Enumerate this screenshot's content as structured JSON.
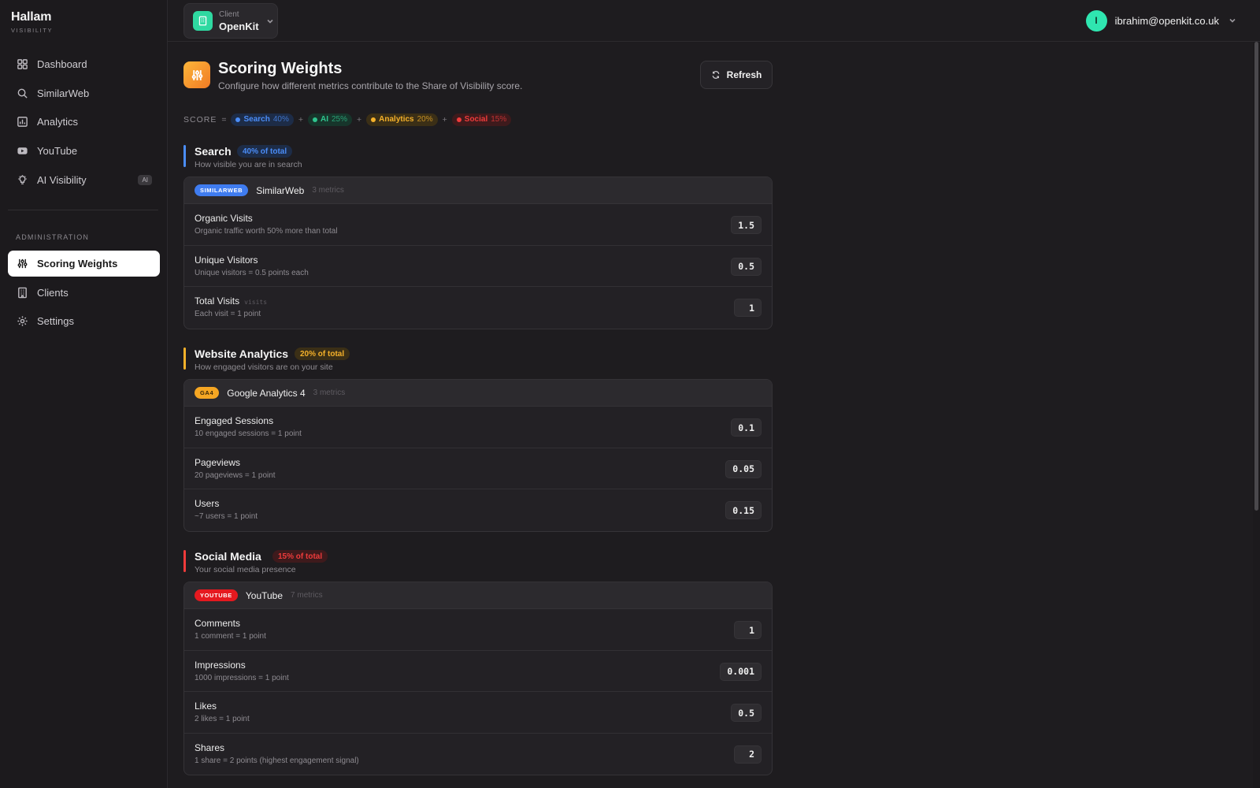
{
  "brand": {
    "name": "Hallam",
    "subtitle": "VISIBILITY"
  },
  "nav": [
    {
      "label": "Dashboard",
      "icon": "grid-icon"
    },
    {
      "label": "SimilarWeb",
      "icon": "search-icon"
    },
    {
      "label": "Analytics",
      "icon": "bar-chart-icon"
    },
    {
      "label": "YouTube",
      "icon": "youtube-icon"
    },
    {
      "label": "AI Visibility",
      "icon": "lightbulb-icon",
      "badge": "AI"
    }
  ],
  "admin": {
    "section_label": "ADMINISTRATION",
    "items": [
      {
        "label": "Scoring Weights",
        "icon": "sliders-icon",
        "active": true
      },
      {
        "label": "Clients",
        "icon": "building-icon"
      },
      {
        "label": "Settings",
        "icon": "gear-icon"
      }
    ]
  },
  "topbar": {
    "client_label": "Client",
    "client_name": "OpenKit",
    "user_initial": "I",
    "user_email": "ibrahim@openkit.co.uk"
  },
  "page": {
    "title": "Scoring Weights",
    "subtitle": "Configure how different metrics contribute to the Share of Visibility score.",
    "refresh_label": "Refresh"
  },
  "formula": {
    "label": "SCORE",
    "equals": "=",
    "plus": "+",
    "parts": [
      {
        "name": "Search",
        "pct": "40%",
        "color": "#4b8df8",
        "bg": "#1d2c47"
      },
      {
        "name": "AI",
        "pct": "25%",
        "color": "#2fc48e",
        "bg": "#17352b"
      },
      {
        "name": "Analytics",
        "pct": "20%",
        "color": "#f5b12a",
        "bg": "#3b2f16"
      },
      {
        "name": "Social",
        "pct": "15%",
        "color": "#ef3b3b",
        "bg": "#3e1a1c"
      }
    ]
  },
  "sections": [
    {
      "title": "Search",
      "badge": "40% of total",
      "color": "#4b8df8",
      "badge_bg": "#1d2c47",
      "description": "How visible you are in search",
      "source_tag": "SIMILARWEB",
      "tag_bg": "#3f7cf0",
      "tag_fg": "#ffffff",
      "source_name": "SimilarWeb",
      "metrics_count": "3 metrics",
      "rows": [
        {
          "name": "Organic Visits",
          "desc": "Organic traffic worth 50% more than total",
          "value": "1.5"
        },
        {
          "name": "Unique Visitors",
          "desc": "Unique visitors = 0.5 points each",
          "value": "0.5"
        },
        {
          "name": "Total Visits",
          "tech": "visits",
          "desc": "Each visit = 1 point",
          "value": "1"
        }
      ]
    },
    {
      "title": "Website Analytics",
      "badge": "20% of total",
      "color": "#f5b12a",
      "badge_bg": "#3b2f16",
      "description": "How engaged visitors are on your site",
      "source_tag": "GA4",
      "tag_bg": "#f5a623",
      "tag_fg": "#3a2608",
      "source_name": "Google Analytics 4",
      "metrics_count": "3 metrics",
      "rows": [
        {
          "name": "Engaged Sessions",
          "desc": "10 engaged sessions = 1 point",
          "value": "0.1"
        },
        {
          "name": "Pageviews",
          "desc": "20 pageviews = 1 point",
          "value": "0.05"
        },
        {
          "name": "Users",
          "desc": "~7 users = 1 point",
          "value": "0.15"
        }
      ]
    },
    {
      "title": "Social Media",
      "badge": "15% of total",
      "color": "#ef3b3b",
      "badge_bg": "#3e1a1c",
      "description": "Your social media presence",
      "source_tag": "YOUTUBE",
      "tag_bg": "#e5191f",
      "tag_fg": "#ffffff",
      "source_name": "YouTube",
      "metrics_count": "7 metrics",
      "rows": [
        {
          "name": "Comments",
          "desc": "1 comment = 1 point",
          "value": "1"
        },
        {
          "name": "Impressions",
          "desc": "1000 impressions = 1 point",
          "value": "0.001"
        },
        {
          "name": "Likes",
          "desc": "2 likes = 1 point",
          "value": "0.5"
        },
        {
          "name": "Shares",
          "desc": "1 share = 2 points (highest engagement signal)",
          "value": "2"
        }
      ]
    }
  ]
}
